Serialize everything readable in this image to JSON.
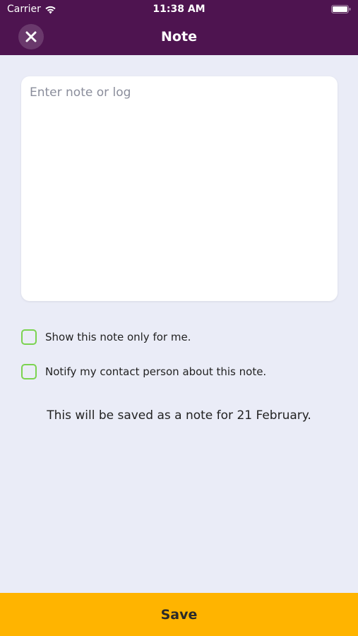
{
  "status_bar": {
    "carrier": "Carrier",
    "time": "11:38 AM",
    "wifi_icon": "wifi-icon",
    "battery_icon": "battery-icon"
  },
  "header": {
    "title": "Note",
    "close_icon": "close-icon"
  },
  "note": {
    "placeholder": "Enter note or log",
    "value": ""
  },
  "options": {
    "private_label": "Show this note only for me.",
    "private_checked": false,
    "notify_label": "Notify my contact person about this note.",
    "notify_checked": false
  },
  "info_text": "This will be saved as a note for 21 February.",
  "footer": {
    "save_label": "Save"
  },
  "colors": {
    "header_bg": "#4E1450",
    "page_bg": "#EAECF7",
    "checkbox_border": "#7BD350",
    "save_bg": "#FFB400"
  }
}
